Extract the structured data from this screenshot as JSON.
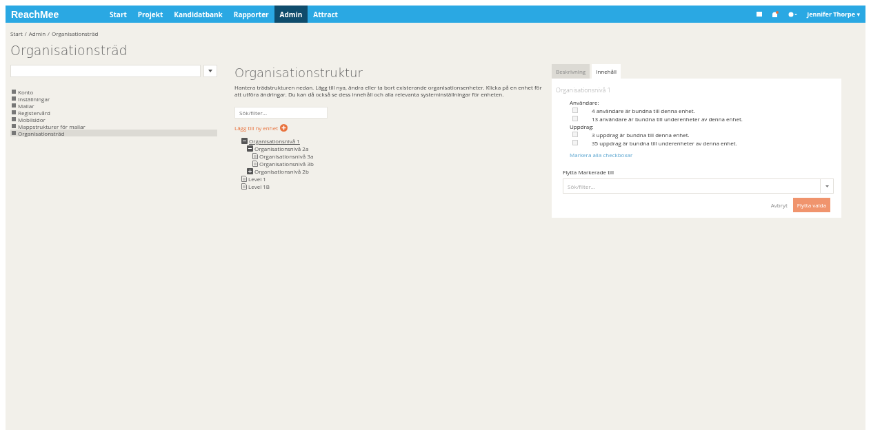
{
  "navbar": {
    "logo": "ReachMee",
    "items": [
      {
        "label": "Start",
        "selected": false
      },
      {
        "label": "Projekt",
        "selected": false
      },
      {
        "label": "Kandidatbank",
        "selected": false
      },
      {
        "label": "Rapporter",
        "selected": false
      },
      {
        "label": "Admin",
        "selected": true
      },
      {
        "label": "Attract",
        "selected": false
      }
    ],
    "user": "Jennifer Thorpe",
    "user_caret": "▾"
  },
  "breadcrumb": {
    "separator": "/",
    "items": [
      "Start",
      "Admin",
      "Organisationsträd"
    ]
  },
  "page_title": "Organisationsträd",
  "sidebar": {
    "items": [
      {
        "label": "Konto",
        "selected": false
      },
      {
        "label": "Inställningar",
        "selected": false
      },
      {
        "label": "Mallar",
        "selected": false
      },
      {
        "label": "Registervård",
        "selected": false
      },
      {
        "label": "Mobilsidor",
        "selected": false
      },
      {
        "label": "Mappstrukturer för mallar",
        "selected": false
      },
      {
        "label": "Organisationsträd",
        "selected": true
      }
    ]
  },
  "structure": {
    "title": "Organisationstruktur",
    "description": "Hantera trädstrukturen nedan. Lägg till nya, ändra eller ta bort existerande organisationsenheter. Klicka på en enhet för att utföra ändringar. Du kan då också se dess innehåll och alla relevanta systeminställningar för enheten.",
    "search": {
      "placeholder": "Sök/filter..."
    },
    "add_label": "Lägg till ny enhet",
    "tree": [
      {
        "label": "Organisationsnivå 1",
        "kind": "branch",
        "expanded": true,
        "selected": true,
        "children": [
          {
            "label": "Organisationsnivå 2a",
            "kind": "branch",
            "expanded": true,
            "selected": false,
            "children": [
              {
                "label": "Organisationsnivå 3a",
                "kind": "leaf",
                "selected": false
              },
              {
                "label": "Organisationsnivå 3b",
                "kind": "leaf",
                "selected": false
              }
            ]
          },
          {
            "label": "Organisationsnivå 2b",
            "kind": "branch",
            "expanded": false,
            "selected": false
          }
        ]
      },
      {
        "label": "Level 1",
        "kind": "leaf",
        "selected": false
      },
      {
        "label": "Level 1B",
        "kind": "leaf",
        "selected": false
      }
    ]
  },
  "detail": {
    "tabs": [
      {
        "label": "Beskrivning",
        "selected": false
      },
      {
        "label": "Innehåll",
        "selected": true
      }
    ],
    "title": "Organisationsnivå 1",
    "groups": [
      {
        "label": "Användare:",
        "items": [
          {
            "text": "4 användare är bundna till denna enhet.",
            "checked": false
          },
          {
            "text": "13 användare är bundna till underenheter av denna enhet.",
            "checked": false
          }
        ]
      },
      {
        "label": "Uppdrag:",
        "items": [
          {
            "text": "3 uppdrag är bundna till denna enhet.",
            "checked": false
          },
          {
            "text": "35 uppdrag är bundna till underenheter av denna enhet.",
            "checked": false
          }
        ]
      }
    ],
    "select_all_link": "Markera alla checkboxar",
    "move_label": "Flytta Markerade till",
    "move_select": {
      "placeholder": "Sök/filter..."
    },
    "cancel": "Avbryt",
    "submit": "Flytta valda"
  }
}
